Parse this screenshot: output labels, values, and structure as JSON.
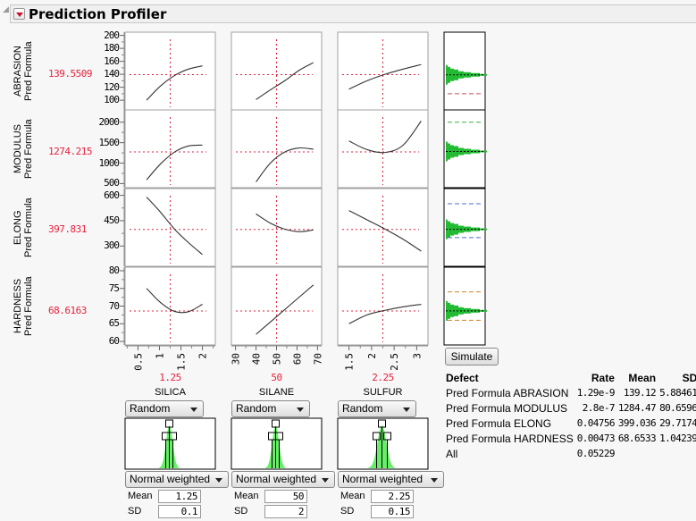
{
  "header": {
    "title": "Prediction Profiler",
    "disclosure_icon": "collapse-triangle",
    "menu_icon": "red-triangle-menu"
  },
  "responses": [
    {
      "line1": "Pred Formula",
      "line2": "ABRASION",
      "current": "139.5509",
      "yticks": [
        "200",
        "180",
        "160",
        "140",
        "120",
        "100"
      ],
      "ymin": 85,
      "ymax": 205,
      "ycur": 139.5509,
      "hist_mean": 139.12,
      "limits": [
        {
          "value": 110,
          "color": "#c0505a"
        }
      ]
    },
    {
      "line1": "Pred Formula",
      "line2": "MODULUS",
      "current": "1274.215",
      "yticks": [
        "2000",
        "1500",
        "1000",
        "500"
      ],
      "ymin": 400,
      "ymax": 2300,
      "ycur": 1274.215,
      "hist_mean": 1284.47,
      "limits": [
        {
          "value": 2000,
          "color": "#3fae3f"
        }
      ]
    },
    {
      "line1": "Pred Formula",
      "line2": "ELONG",
      "current": "397.831",
      "yticks": [
        "600",
        "450",
        "300"
      ],
      "ymin": 180,
      "ymax": 640,
      "ycur": 397.831,
      "hist_mean": 399.036,
      "limits": [
        {
          "value": 550,
          "color": "#4a6fd0"
        },
        {
          "value": 350,
          "color": "#4a6fd0"
        }
      ]
    },
    {
      "line1": "Pred Formula",
      "line2": "HARDNESS",
      "current": "68.6163",
      "yticks": [
        "80",
        "75",
        "70",
        "65",
        "60"
      ],
      "ymin": 59,
      "ymax": 81,
      "ycur": 68.6163,
      "hist_mean": 68.6533,
      "limits": [
        {
          "value": 74,
          "color": "#d0802a"
        },
        {
          "value": 66,
          "color": "#d0802a"
        }
      ]
    }
  ],
  "factors": [
    {
      "name": "SILICA",
      "current": "1.25",
      "xmin": 0.2,
      "xmax": 2.3,
      "xcur": 1.25,
      "xticks": [
        "0.5",
        "1",
        "1.5",
        "2"
      ],
      "xtick_values": [
        0.5,
        1,
        1.5,
        2
      ],
      "curve_xrange": [
        0.7,
        2
      ],
      "dist_mode": "Random",
      "dist_type": "Normal weighted",
      "mean_label": "Mean",
      "mean": "1.25",
      "sd_label": "SD",
      "sd": "0.1"
    },
    {
      "name": "SILANE",
      "current": "50",
      "xmin": 28,
      "xmax": 72,
      "xcur": 50,
      "xticks": [
        "30",
        "40",
        "50",
        "60",
        "70"
      ],
      "xtick_values": [
        30,
        40,
        50,
        60,
        70
      ],
      "curve_xrange": [
        40,
        68
      ],
      "dist_mode": "Random",
      "dist_type": "Normal weighted",
      "mean_label": "Mean",
      "mean": "50",
      "sd_label": "SD",
      "sd": "2"
    },
    {
      "name": "SULFUR",
      "current": "2.25",
      "xmin": 1.25,
      "xmax": 3.25,
      "xcur": 2.25,
      "xticks": [
        "1.5",
        "2",
        "2.5",
        "3"
      ],
      "xtick_values": [
        1.5,
        2,
        2.5,
        3
      ],
      "curve_xrange": [
        1.5,
        3.1
      ],
      "dist_mode": "Random",
      "dist_type": "Normal weighted",
      "mean_label": "Mean",
      "mean": "2.25",
      "sd_label": "SD",
      "sd": "0.15"
    }
  ],
  "curves": [
    [
      [
        100,
        122,
        138,
        148,
        153
      ],
      [
        101,
        116,
        130,
        146,
        158
      ],
      [
        117,
        130,
        140,
        148,
        155
      ]
    ],
    [
      [
        590,
        980,
        1270,
        1420,
        1440
      ],
      [
        540,
        1000,
        1270,
        1370,
        1340
      ],
      [
        1540,
        1330,
        1260,
        1440,
        2030
      ]
    ],
    [
      [
        590,
        500,
        400,
        320,
        250
      ],
      [
        490,
        435,
        400,
        385,
        395
      ],
      [
        510,
        455,
        400,
        340,
        270
      ]
    ],
    [
      [
        75,
        71,
        68.5,
        68.4,
        70.5
      ],
      [
        62,
        65.5,
        69,
        72.5,
        76
      ],
      [
        65,
        67.5,
        68.8,
        69.8,
        70.5
      ]
    ]
  ],
  "simulate_button": "Simulate",
  "defect_table": {
    "headers": [
      "Defect",
      "Rate",
      "Mean",
      "SD"
    ],
    "rows": [
      [
        "Pred Formula ABRASION",
        "1.29e-9",
        "139.12",
        "5.88461"
      ],
      [
        "Pred Formula MODULUS",
        "2.8e-7",
        "1284.47",
        "80.6596"
      ],
      [
        "Pred Formula ELONG",
        "0.04756",
        "399.036",
        "29.7174"
      ],
      [
        "Pred Formula HARDNESS",
        "0.00473",
        "68.6533",
        "1.04239"
      ],
      [
        "All",
        "0.05229",
        "",
        ""
      ]
    ]
  },
  "colors": {
    "accent_red": "#e8203c",
    "hist_green": "#22bb33",
    "dist_green": "#66ee66"
  }
}
